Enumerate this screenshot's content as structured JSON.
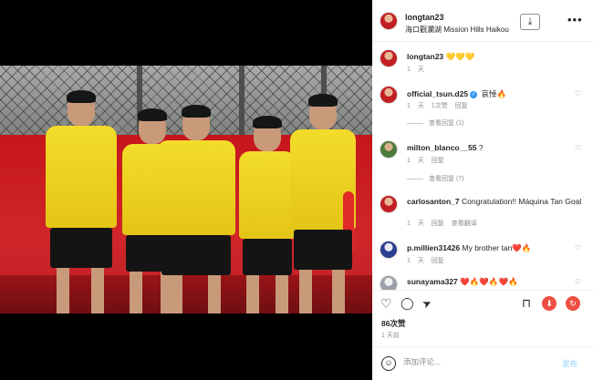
{
  "post": {
    "author": "longtan23",
    "location": "海口觀瀾湖 Mission Hills Haikou"
  },
  "comments": [
    {
      "user": "longtan23",
      "text": "💛💛💛",
      "time": "1 天",
      "verified": false,
      "like_label": "",
      "reply_label": "",
      "view_replies": "",
      "avatar_color": "#c21f22"
    },
    {
      "user": "official_tsun.d25",
      "text": "哀悼🔥",
      "time": "1 天",
      "verified": true,
      "like_label": "1次赞",
      "reply_label": "回复",
      "view_replies": "查看回复 (1)",
      "avatar_color": "#c21f22"
    },
    {
      "user": "milton_blanco__55",
      "text": "?",
      "time": "1 天",
      "verified": false,
      "like_label": "",
      "reply_label": "回复",
      "view_replies": "查看回复 (7)",
      "avatar_color": "#4c7a3a"
    },
    {
      "user": "carlosanton_7",
      "text": "Congratulation!! Máquina Tan Goal",
      "time": "1 天",
      "verified": false,
      "like_label": "回复",
      "reply_label": "查看翻译",
      "view_replies": "",
      "avatar_color": "#c21f22"
    },
    {
      "user": "p.millien31426",
      "text": "My brother tan❤️🔥",
      "time": "1 天",
      "verified": false,
      "like_label": "",
      "reply_label": "回复",
      "view_replies": "",
      "avatar_color": "#2a3f8f"
    },
    {
      "user": "sunayama327",
      "text": "❤️🔥❤️🔥❤️🔥",
      "time": "",
      "verified": false,
      "like_label": "",
      "reply_label": "",
      "view_replies": "",
      "avatar_color": "#9aa0a6"
    }
  ],
  "actions": {
    "like_icon": "♡",
    "comment_icon": "◯",
    "share_icon": "➤",
    "save_icon": "⊓",
    "download_icon": "⬇",
    "repost_icon": "↻"
  },
  "likes": "86次赞",
  "date": "1 天前",
  "add_comment": {
    "placeholder": "添加评论...",
    "post_label": "发布"
  },
  "colors": {
    "accent_blue": "#3897f0",
    "red_button": "#ed4f43",
    "kit_yellow": "#f3dc2a",
    "banner_red": "#c5161c"
  }
}
